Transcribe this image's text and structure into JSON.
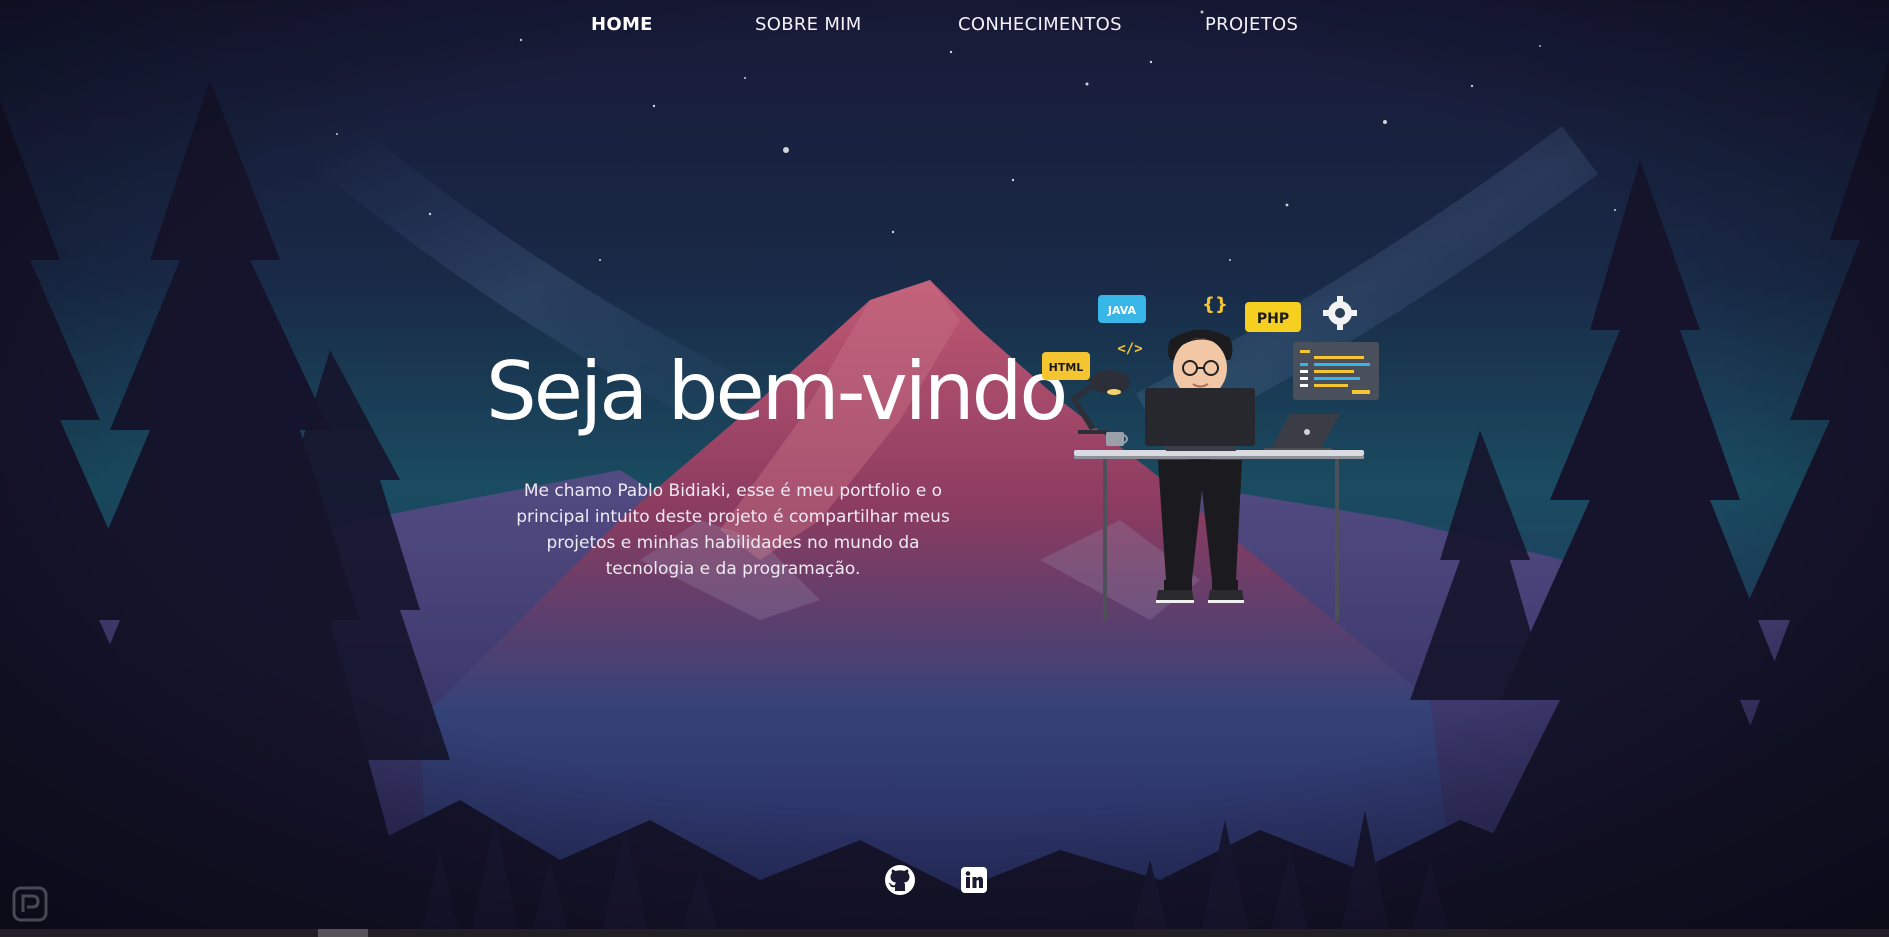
{
  "nav": {
    "items": [
      {
        "label": "HOME",
        "active": true
      },
      {
        "label": "SOBRE MIM",
        "active": false
      },
      {
        "label": "CONHECIMENTOS",
        "active": false
      },
      {
        "label": "PROJETOS",
        "active": false
      }
    ]
  },
  "hero": {
    "title": "Seja bem-vindo",
    "description": "Me chamo Pablo Bidiaki, esse é meu portfolio e o principal intuito deste projeto é compartilhar meus projetos e minhas habilidades no mundo da tecnologia e da programação."
  },
  "illustration": {
    "badges": {
      "java": "JAVA",
      "php": "PHP",
      "html": "HTML",
      "braces": "{}",
      "code_tag": "</>"
    }
  },
  "socials": [
    {
      "icon": "github-icon"
    },
    {
      "icon": "linkedin-icon"
    }
  ],
  "colors": {
    "sky_top": "#1c1f3e",
    "sky_mid": "#1f5d73",
    "mountain_glow": "#e0607e",
    "forest": "#1b1a34",
    "badge_yellow": "#f5c531",
    "badge_blue": "#38b6e8"
  }
}
